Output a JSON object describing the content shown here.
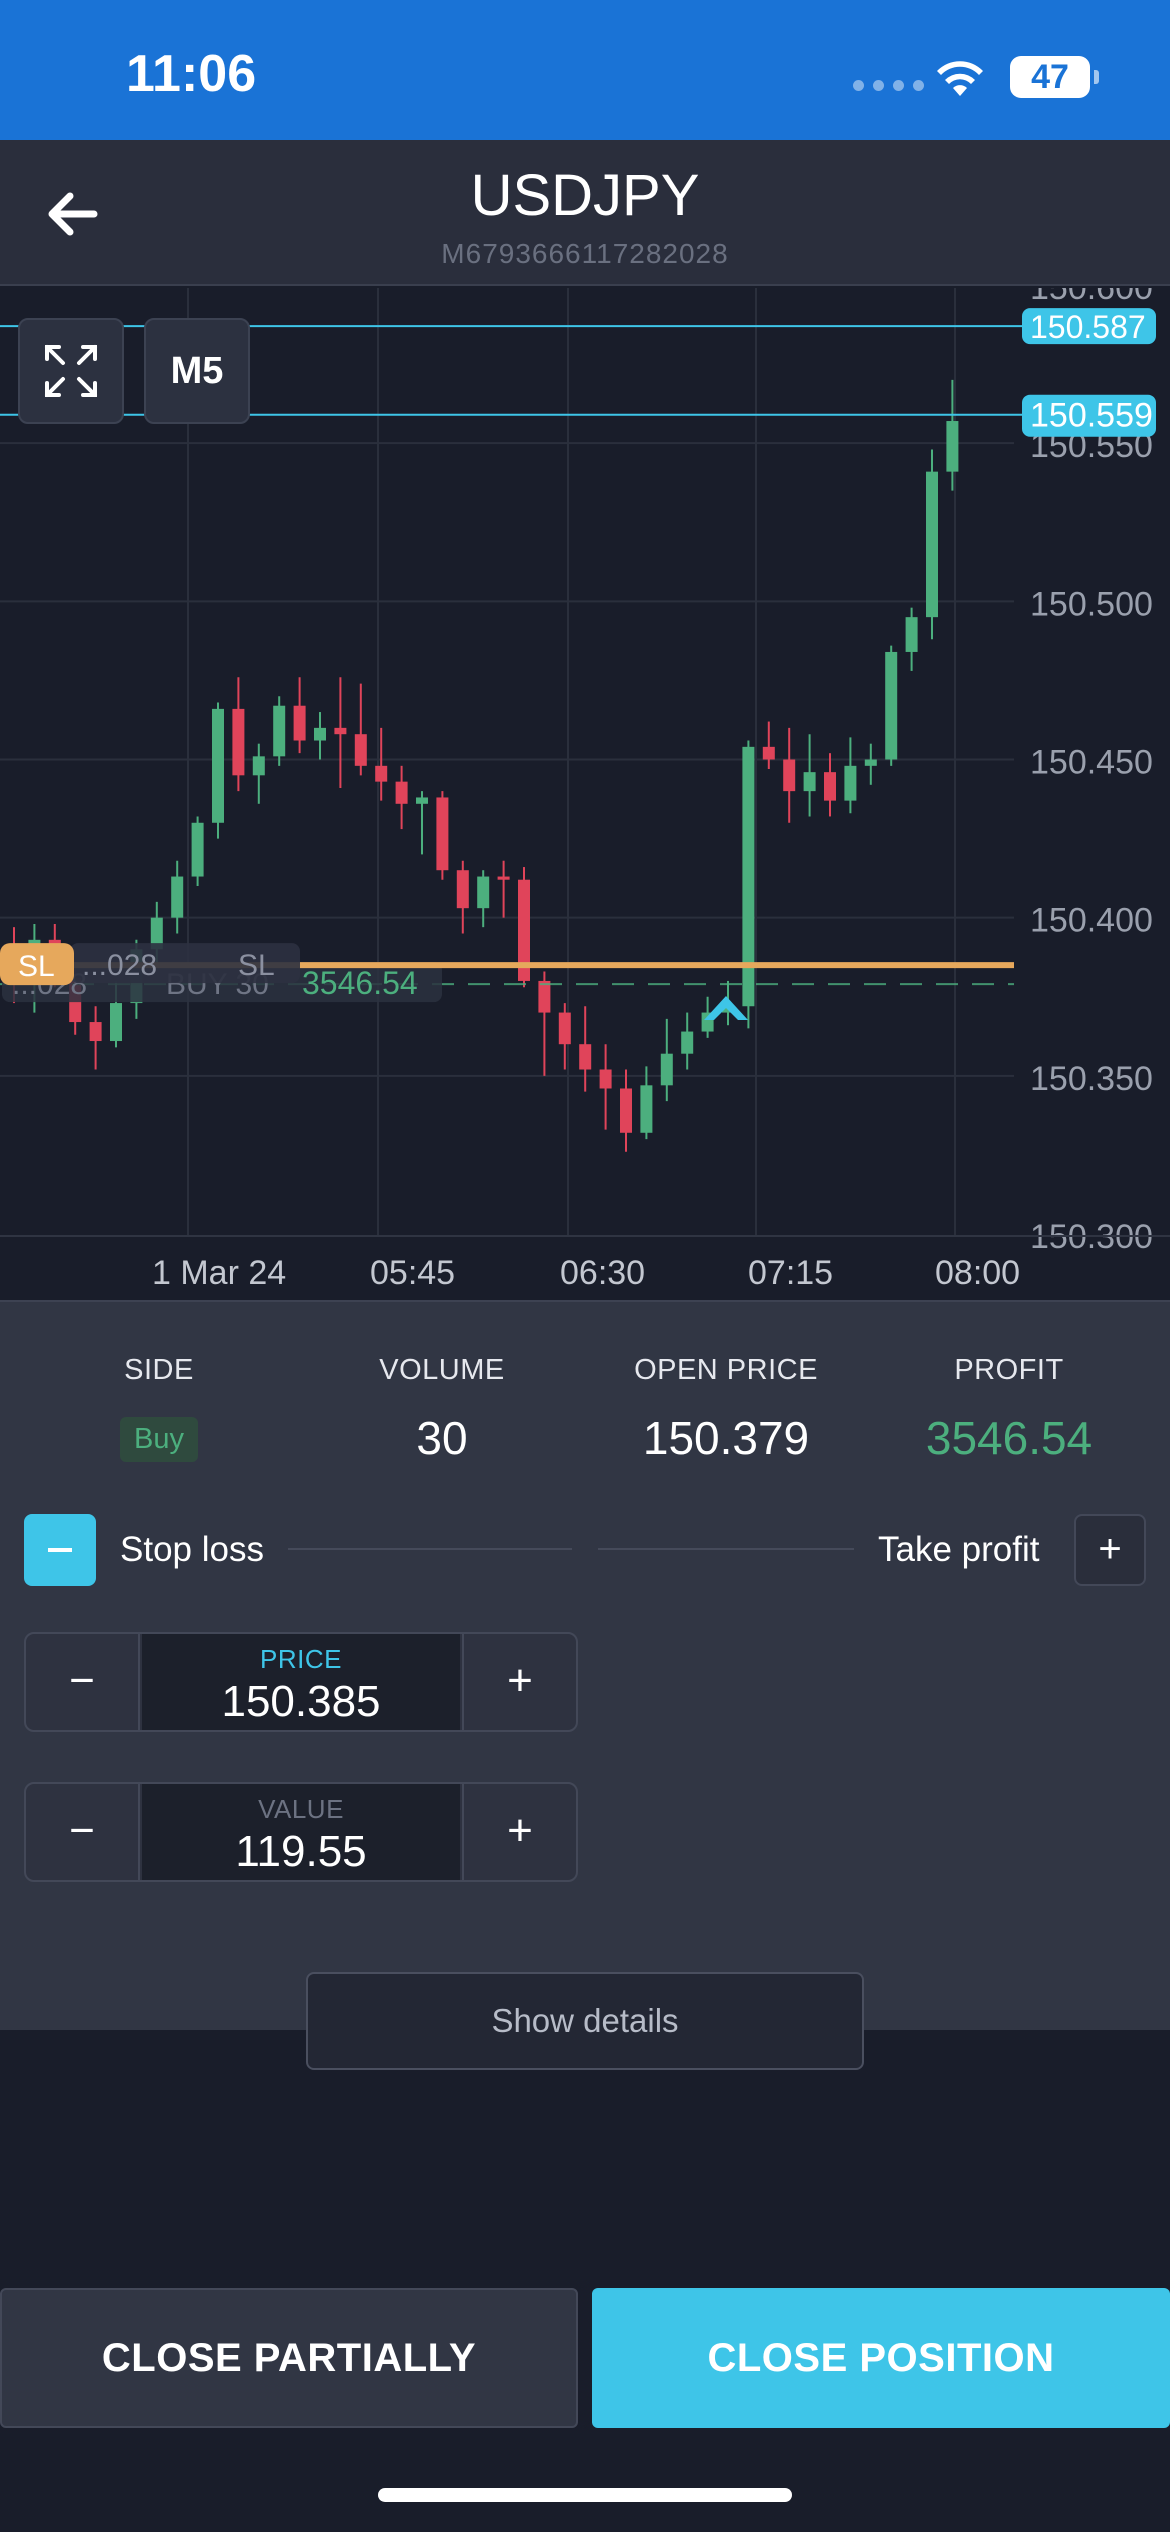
{
  "status_bar": {
    "time": "11:06",
    "battery": "47"
  },
  "header": {
    "title": "USDJPY",
    "subtitle": "M6793666117282028"
  },
  "chart_controls": {
    "timeframe": "M5"
  },
  "chart_data": {
    "type": "candlestick",
    "price_axis": {
      "ticks": [
        "150.600",
        "150.550",
        "150.500",
        "150.450",
        "150.400",
        "150.350",
        "150.300"
      ],
      "range": [
        150.3,
        150.6
      ]
    },
    "time_axis": {
      "ticks": [
        "1 Mar 24",
        "05:45",
        "06:30",
        "07:15",
        "08:00"
      ]
    },
    "current_price_labels": [
      "150.587",
      "150.559"
    ],
    "stop_loss_line": {
      "tag": "SL",
      "label": "...028",
      "text": "SL",
      "price": 150.385
    },
    "position_line": {
      "label": "...028",
      "side_text": "BUY 30",
      "profit": "3546.54",
      "price": 150.379
    },
    "candles": [
      {
        "o": 150.39,
        "h": 150.397,
        "l": 150.373,
        "c": 150.382
      },
      {
        "o": 150.382,
        "h": 150.398,
        "l": 150.37,
        "c": 150.393
      },
      {
        "o": 150.393,
        "h": 150.398,
        "l": 150.378,
        "c": 150.381
      },
      {
        "o": 150.381,
        "h": 150.386,
        "l": 150.363,
        "c": 150.367
      },
      {
        "o": 150.367,
        "h": 150.372,
        "l": 150.352,
        "c": 150.361
      },
      {
        "o": 150.361,
        "h": 150.38,
        "l": 150.359,
        "c": 150.373
      },
      {
        "o": 150.373,
        "h": 150.393,
        "l": 150.368,
        "c": 150.39
      },
      {
        "o": 150.39,
        "h": 150.405,
        "l": 150.385,
        "c": 150.4
      },
      {
        "o": 150.4,
        "h": 150.418,
        "l": 150.395,
        "c": 150.413
      },
      {
        "o": 150.413,
        "h": 150.432,
        "l": 150.41,
        "c": 150.43
      },
      {
        "o": 150.43,
        "h": 150.468,
        "l": 150.425,
        "c": 150.466
      },
      {
        "o": 150.466,
        "h": 150.476,
        "l": 150.44,
        "c": 150.445
      },
      {
        "o": 150.445,
        "h": 150.455,
        "l": 150.436,
        "c": 150.451
      },
      {
        "o": 150.451,
        "h": 150.47,
        "l": 150.448,
        "c": 150.467
      },
      {
        "o": 150.467,
        "h": 150.476,
        "l": 150.452,
        "c": 150.456
      },
      {
        "o": 150.456,
        "h": 150.465,
        "l": 150.45,
        "c": 150.46
      },
      {
        "o": 150.46,
        "h": 150.476,
        "l": 150.441,
        "c": 150.458
      },
      {
        "o": 150.458,
        "h": 150.474,
        "l": 150.445,
        "c": 150.448
      },
      {
        "o": 150.448,
        "h": 150.46,
        "l": 150.437,
        "c": 150.443
      },
      {
        "o": 150.443,
        "h": 150.448,
        "l": 150.428,
        "c": 150.436
      },
      {
        "o": 150.436,
        "h": 150.44,
        "l": 150.42,
        "c": 150.438
      },
      {
        "o": 150.438,
        "h": 150.44,
        "l": 150.412,
        "c": 150.415
      },
      {
        "o": 150.415,
        "h": 150.418,
        "l": 150.395,
        "c": 150.403
      },
      {
        "o": 150.403,
        "h": 150.415,
        "l": 150.397,
        "c": 150.413
      },
      {
        "o": 150.413,
        "h": 150.418,
        "l": 150.4,
        "c": 150.412
      },
      {
        "o": 150.412,
        "h": 150.416,
        "l": 150.378,
        "c": 150.38
      },
      {
        "o": 150.38,
        "h": 150.383,
        "l": 150.35,
        "c": 150.37
      },
      {
        "o": 150.37,
        "h": 150.373,
        "l": 150.352,
        "c": 150.36
      },
      {
        "o": 150.36,
        "h": 150.372,
        "l": 150.345,
        "c": 150.352
      },
      {
        "o": 150.352,
        "h": 150.36,
        "l": 150.333,
        "c": 150.346
      },
      {
        "o": 150.346,
        "h": 150.352,
        "l": 150.326,
        "c": 150.332
      },
      {
        "o": 150.332,
        "h": 150.353,
        "l": 150.33,
        "c": 150.347
      },
      {
        "o": 150.347,
        "h": 150.368,
        "l": 150.342,
        "c": 150.357
      },
      {
        "o": 150.357,
        "h": 150.37,
        "l": 150.352,
        "c": 150.364
      },
      {
        "o": 150.364,
        "h": 150.375,
        "l": 150.362,
        "c": 150.37
      },
      {
        "o": 150.37,
        "h": 150.38,
        "l": 150.366,
        "c": 150.372
      },
      {
        "o": 150.372,
        "h": 150.456,
        "l": 150.365,
        "c": 150.454
      },
      {
        "o": 150.454,
        "h": 150.462,
        "l": 150.447,
        "c": 150.45
      },
      {
        "o": 150.45,
        "h": 150.46,
        "l": 150.43,
        "c": 150.44
      },
      {
        "o": 150.44,
        "h": 150.458,
        "l": 150.432,
        "c": 150.446
      },
      {
        "o": 150.446,
        "h": 150.452,
        "l": 150.432,
        "c": 150.437
      },
      {
        "o": 150.437,
        "h": 150.457,
        "l": 150.433,
        "c": 150.448
      },
      {
        "o": 150.448,
        "h": 150.455,
        "l": 150.442,
        "c": 150.45
      },
      {
        "o": 150.45,
        "h": 150.486,
        "l": 150.448,
        "c": 150.484
      },
      {
        "o": 150.484,
        "h": 150.498,
        "l": 150.478,
        "c": 150.495
      },
      {
        "o": 150.495,
        "h": 150.548,
        "l": 150.488,
        "c": 150.541
      },
      {
        "o": 150.541,
        "h": 150.57,
        "l": 150.535,
        "c": 150.557
      }
    ]
  },
  "position": {
    "side_label": "SIDE",
    "side_value": "Buy",
    "volume_label": "VOLUME",
    "volume_value": "30",
    "open_price_label": "OPEN PRICE",
    "open_price_value": "150.379",
    "profit_label": "PROFIT",
    "profit_value": "3546.54"
  },
  "stop_loss": {
    "label": "Stop loss",
    "price_caption": "PRICE",
    "price_value": "150.385",
    "value_caption": "VALUE",
    "value_value": "119.55",
    "minus": "−",
    "plus": "+"
  },
  "take_profit": {
    "label": "Take profit",
    "add": "+"
  },
  "details_button": "Show details",
  "actions": {
    "close_partially": "CLOSE PARTIALLY",
    "close_position": "CLOSE POSITION"
  },
  "colors": {
    "up": "#4caf7e",
    "down": "#e0445a",
    "accent": "#3ec5e8",
    "stop_loss": "#e6a85c"
  }
}
